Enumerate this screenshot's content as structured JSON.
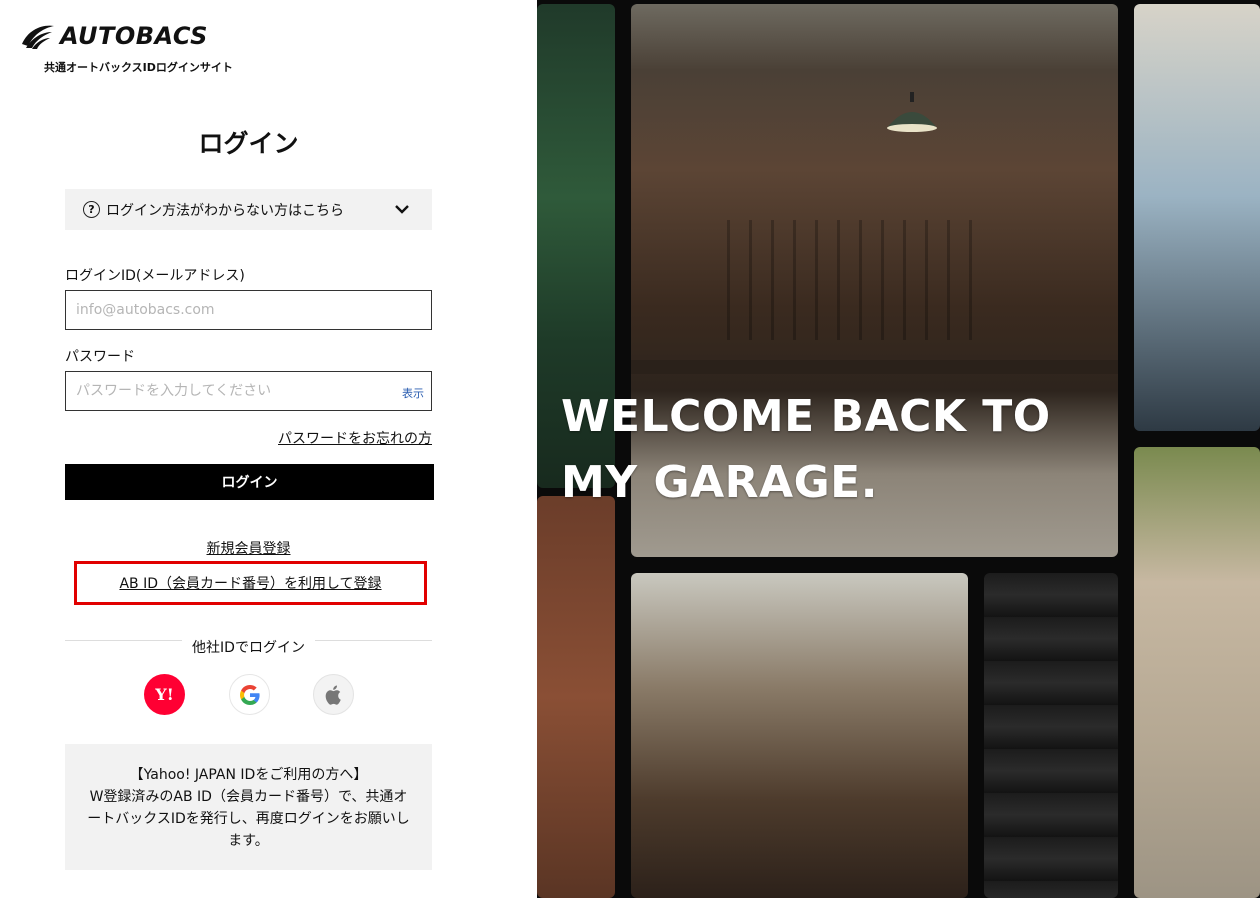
{
  "brand": {
    "logo_text": "AUTOBACS",
    "tagline": "共通オートバックスIDログインサイト"
  },
  "page": {
    "title": "ログイン"
  },
  "help": {
    "label": "ログイン方法がわからない方はこちら",
    "icon": "question-circle-icon"
  },
  "form": {
    "login_id_label": "ログインID(メールアドレス)",
    "login_id_placeholder": "info@autobacs.com",
    "login_id_value": "",
    "password_label": "パスワード",
    "password_placeholder": "パスワードを入力してください",
    "password_value": "",
    "show_label": "表示",
    "forgot_label": "パスワードをお忘れの方",
    "submit_label": "ログイン"
  },
  "registration": {
    "new_member": "新規会員登録",
    "ab_id_register": "AB ID（会員カード番号）を利用して登録"
  },
  "social": {
    "heading": "他社IDでログイン",
    "providers": [
      "Yahoo",
      "Google",
      "Apple"
    ],
    "yahoo_mark": "Y!"
  },
  "notice": {
    "title": "【Yahoo! JAPAN IDをご利用の方へ】",
    "body": "W登録済みのAB ID（会員カード番号）で、共通オートバックスIDを発行し、再度ログインをお願いします。"
  },
  "hero": {
    "line1": "WELCOME BACK TO",
    "line2": "MY GARAGE."
  },
  "colors": {
    "highlight_border": "#e10000",
    "primary_button": "#000000",
    "yahoo_red": "#ff0033",
    "link_blue": "#2a5db0"
  }
}
